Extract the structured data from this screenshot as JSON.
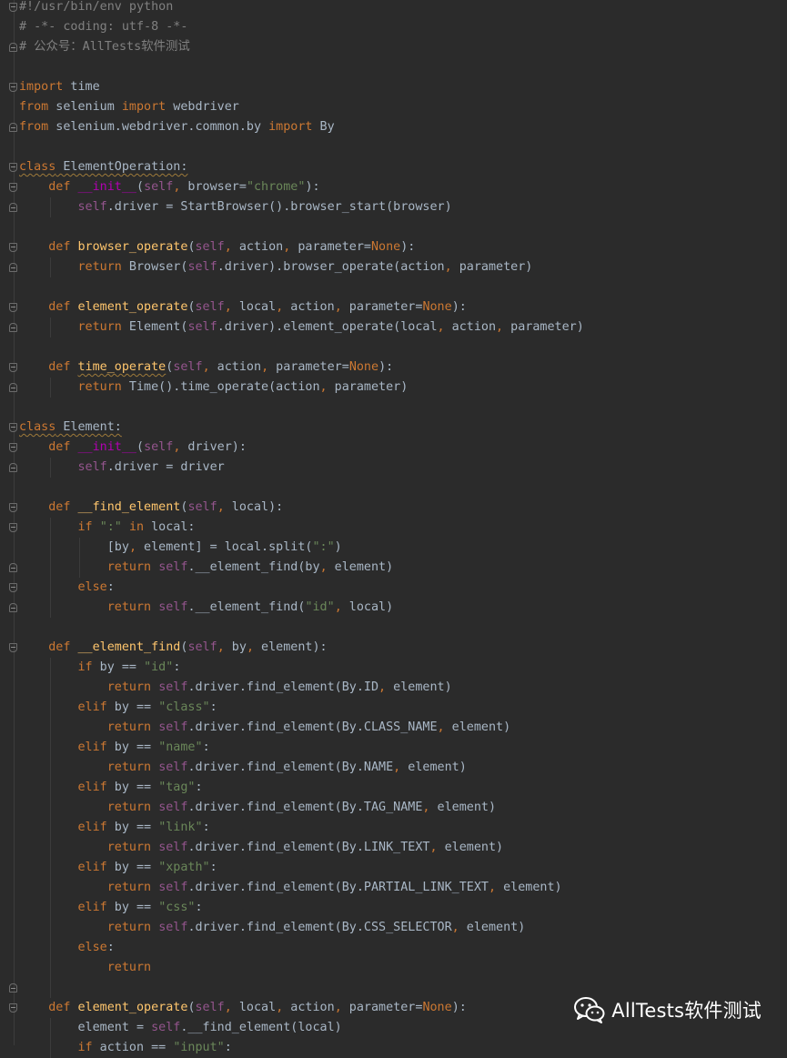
{
  "editor": {
    "language": "python",
    "colors": {
      "background": "#2b2b2b",
      "keyword": "#cc7832",
      "comment": "#808080",
      "string": "#6a8759",
      "self": "#94558d",
      "magic": "#b200b2",
      "function": "#ffc66d",
      "text": "#a9b7c6"
    },
    "lines": [
      [
        [
          "c",
          "#!/usr/bin/env python"
        ]
      ],
      [
        [
          "c",
          "# -*- coding: utf-8 -*-"
        ]
      ],
      [
        [
          "c",
          "# 公众号：AllTests软件测试"
        ]
      ],
      [],
      [
        [
          "k",
          "import"
        ],
        [
          "t",
          " time"
        ]
      ],
      [
        [
          "k",
          "from"
        ],
        [
          "t",
          " selenium "
        ],
        [
          "k",
          "import"
        ],
        [
          "t",
          " webdriver"
        ]
      ],
      [
        [
          "k",
          "from"
        ],
        [
          "t",
          " selenium.webdriver.common.by "
        ],
        [
          "k",
          "import"
        ],
        [
          "t",
          " By"
        ]
      ],
      [],
      [
        [
          "ku",
          "class"
        ],
        [
          "tu",
          " ElementOperation:"
        ]
      ],
      [
        [
          "t",
          "    "
        ],
        [
          "k",
          "def"
        ],
        [
          "t",
          " "
        ],
        [
          "m",
          "__init__"
        ],
        [
          "t",
          "("
        ],
        [
          "sf",
          "self"
        ],
        [
          "k",
          ","
        ],
        [
          "t",
          " browser="
        ],
        [
          "s",
          "\"chrome\""
        ],
        [
          "t",
          "):"
        ]
      ],
      [
        [
          "t",
          "        "
        ],
        [
          "sf",
          "self"
        ],
        [
          "t",
          ".driver = StartBrowser().browser_start(browser)"
        ]
      ],
      [],
      [
        [
          "t",
          "    "
        ],
        [
          "k",
          "def"
        ],
        [
          "t",
          " "
        ],
        [
          "f",
          "browser_operate"
        ],
        [
          "t",
          "("
        ],
        [
          "sf",
          "self"
        ],
        [
          "k",
          ","
        ],
        [
          "t",
          " action"
        ],
        [
          "k",
          ","
        ],
        [
          "t",
          " parameter="
        ],
        [
          "k",
          "None"
        ],
        [
          "t",
          "):"
        ]
      ],
      [
        [
          "t",
          "        "
        ],
        [
          "k",
          "return"
        ],
        [
          "t",
          " Browser("
        ],
        [
          "sf",
          "self"
        ],
        [
          "t",
          ".driver).browser_operate(action"
        ],
        [
          "k",
          ","
        ],
        [
          "t",
          " parameter)"
        ]
      ],
      [],
      [
        [
          "t",
          "    "
        ],
        [
          "k",
          "def"
        ],
        [
          "t",
          " "
        ],
        [
          "f",
          "element_operate"
        ],
        [
          "t",
          "("
        ],
        [
          "sf",
          "self"
        ],
        [
          "k",
          ","
        ],
        [
          "t",
          " local"
        ],
        [
          "k",
          ","
        ],
        [
          "t",
          " action"
        ],
        [
          "k",
          ","
        ],
        [
          "t",
          " parameter="
        ],
        [
          "k",
          "None"
        ],
        [
          "t",
          "):"
        ]
      ],
      [
        [
          "t",
          "        "
        ],
        [
          "k",
          "return"
        ],
        [
          "t",
          " Element("
        ],
        [
          "sf",
          "self"
        ],
        [
          "t",
          ".driver).element_operate(local"
        ],
        [
          "k",
          ","
        ],
        [
          "t",
          " action"
        ],
        [
          "k",
          ","
        ],
        [
          "t",
          " parameter)"
        ]
      ],
      [],
      [
        [
          "t",
          "    "
        ],
        [
          "k",
          "def"
        ],
        [
          "t",
          " "
        ],
        [
          "fu",
          "time_operate"
        ],
        [
          "t",
          "("
        ],
        [
          "sf",
          "self"
        ],
        [
          "k",
          ","
        ],
        [
          "t",
          " action"
        ],
        [
          "k",
          ","
        ],
        [
          "t",
          " parameter="
        ],
        [
          "k",
          "None"
        ],
        [
          "t",
          "):"
        ]
      ],
      [
        [
          "t",
          "        "
        ],
        [
          "k",
          "return"
        ],
        [
          "t",
          " Time().time_operate(action"
        ],
        [
          "k",
          ","
        ],
        [
          "t",
          " parameter)"
        ]
      ],
      [],
      [
        [
          "ku",
          "class"
        ],
        [
          "tu",
          " Element:"
        ]
      ],
      [
        [
          "t",
          "    "
        ],
        [
          "k",
          "def"
        ],
        [
          "t",
          " "
        ],
        [
          "m",
          "__init__"
        ],
        [
          "t",
          "("
        ],
        [
          "sf",
          "self"
        ],
        [
          "k",
          ","
        ],
        [
          "t",
          " driver):"
        ]
      ],
      [
        [
          "t",
          "        "
        ],
        [
          "sf",
          "self"
        ],
        [
          "t",
          ".driver = driver"
        ]
      ],
      [],
      [
        [
          "t",
          "    "
        ],
        [
          "k",
          "def"
        ],
        [
          "t",
          " "
        ],
        [
          "f",
          "__find_element"
        ],
        [
          "t",
          "("
        ],
        [
          "sf",
          "self"
        ],
        [
          "k",
          ","
        ],
        [
          "t",
          " local):"
        ]
      ],
      [
        [
          "t",
          "        "
        ],
        [
          "k",
          "if"
        ],
        [
          "t",
          " "
        ],
        [
          "s",
          "\":\""
        ],
        [
          "t",
          " "
        ],
        [
          "k",
          "in"
        ],
        [
          "t",
          " local:"
        ]
      ],
      [
        [
          "t",
          "            [by"
        ],
        [
          "k",
          ","
        ],
        [
          "t",
          " element] = local.split("
        ],
        [
          "s",
          "\":\""
        ],
        [
          "t",
          ")"
        ]
      ],
      [
        [
          "t",
          "            "
        ],
        [
          "k",
          "return"
        ],
        [
          "t",
          " "
        ],
        [
          "sf",
          "self"
        ],
        [
          "t",
          ".__element_find(by"
        ],
        [
          "k",
          ","
        ],
        [
          "t",
          " element)"
        ]
      ],
      [
        [
          "t",
          "        "
        ],
        [
          "k",
          "else"
        ],
        [
          "t",
          ":"
        ]
      ],
      [
        [
          "t",
          "            "
        ],
        [
          "k",
          "return"
        ],
        [
          "t",
          " "
        ],
        [
          "sf",
          "self"
        ],
        [
          "t",
          ".__element_find("
        ],
        [
          "s",
          "\"id\""
        ],
        [
          "k",
          ","
        ],
        [
          "t",
          " local)"
        ]
      ],
      [],
      [
        [
          "t",
          "    "
        ],
        [
          "k",
          "def"
        ],
        [
          "t",
          " "
        ],
        [
          "f",
          "__element_find"
        ],
        [
          "t",
          "("
        ],
        [
          "sf",
          "self"
        ],
        [
          "k",
          ","
        ],
        [
          "t",
          " by"
        ],
        [
          "k",
          ","
        ],
        [
          "t",
          " element):"
        ]
      ],
      [
        [
          "t",
          "        "
        ],
        [
          "k",
          "if"
        ],
        [
          "t",
          " by == "
        ],
        [
          "s",
          "\"id\""
        ],
        [
          "t",
          ":"
        ]
      ],
      [
        [
          "t",
          "            "
        ],
        [
          "k",
          "return"
        ],
        [
          "t",
          " "
        ],
        [
          "sf",
          "self"
        ],
        [
          "t",
          ".driver.find_element(By.ID"
        ],
        [
          "k",
          ","
        ],
        [
          "t",
          " element)"
        ]
      ],
      [
        [
          "t",
          "        "
        ],
        [
          "k",
          "elif"
        ],
        [
          "t",
          " by == "
        ],
        [
          "s",
          "\"class\""
        ],
        [
          "t",
          ":"
        ]
      ],
      [
        [
          "t",
          "            "
        ],
        [
          "k",
          "return"
        ],
        [
          "t",
          " "
        ],
        [
          "sf",
          "self"
        ],
        [
          "t",
          ".driver.find_element(By.CLASS_NAME"
        ],
        [
          "k",
          ","
        ],
        [
          "t",
          " element)"
        ]
      ],
      [
        [
          "t",
          "        "
        ],
        [
          "k",
          "elif"
        ],
        [
          "t",
          " by == "
        ],
        [
          "s",
          "\"name\""
        ],
        [
          "t",
          ":"
        ]
      ],
      [
        [
          "t",
          "            "
        ],
        [
          "k",
          "return"
        ],
        [
          "t",
          " "
        ],
        [
          "sf",
          "self"
        ],
        [
          "t",
          ".driver.find_element(By.NAME"
        ],
        [
          "k",
          ","
        ],
        [
          "t",
          " element)"
        ]
      ],
      [
        [
          "t",
          "        "
        ],
        [
          "k",
          "elif"
        ],
        [
          "t",
          " by == "
        ],
        [
          "s",
          "\"tag\""
        ],
        [
          "t",
          ":"
        ]
      ],
      [
        [
          "t",
          "            "
        ],
        [
          "k",
          "return"
        ],
        [
          "t",
          " "
        ],
        [
          "sf",
          "self"
        ],
        [
          "t",
          ".driver.find_element(By.TAG_NAME"
        ],
        [
          "k",
          ","
        ],
        [
          "t",
          " element)"
        ]
      ],
      [
        [
          "t",
          "        "
        ],
        [
          "k",
          "elif"
        ],
        [
          "t",
          " by == "
        ],
        [
          "s",
          "\"link\""
        ],
        [
          "t",
          ":"
        ]
      ],
      [
        [
          "t",
          "            "
        ],
        [
          "k",
          "return"
        ],
        [
          "t",
          " "
        ],
        [
          "sf",
          "self"
        ],
        [
          "t",
          ".driver.find_element(By.LINK_TEXT"
        ],
        [
          "k",
          ","
        ],
        [
          "t",
          " element)"
        ]
      ],
      [
        [
          "t",
          "        "
        ],
        [
          "k",
          "elif"
        ],
        [
          "t",
          " by == "
        ],
        [
          "s",
          "\"xpath\""
        ],
        [
          "t",
          ":"
        ]
      ],
      [
        [
          "t",
          "            "
        ],
        [
          "k",
          "return"
        ],
        [
          "t",
          " "
        ],
        [
          "sf",
          "self"
        ],
        [
          "t",
          ".driver.find_element(By.PARTIAL_LINK_TEXT"
        ],
        [
          "k",
          ","
        ],
        [
          "t",
          " element)"
        ]
      ],
      [
        [
          "t",
          "        "
        ],
        [
          "k",
          "elif"
        ],
        [
          "t",
          " by == "
        ],
        [
          "s",
          "\"css\""
        ],
        [
          "t",
          ":"
        ]
      ],
      [
        [
          "t",
          "            "
        ],
        [
          "k",
          "return"
        ],
        [
          "t",
          " "
        ],
        [
          "sf",
          "self"
        ],
        [
          "t",
          ".driver.find_element(By.CSS_SELECTOR"
        ],
        [
          "k",
          ","
        ],
        [
          "t",
          " element)"
        ]
      ],
      [
        [
          "t",
          "        "
        ],
        [
          "k",
          "else"
        ],
        [
          "t",
          ":"
        ]
      ],
      [
        [
          "t",
          "            "
        ],
        [
          "k",
          "return"
        ]
      ],
      [],
      [
        [
          "t",
          "    "
        ],
        [
          "k",
          "def"
        ],
        [
          "t",
          " "
        ],
        [
          "f",
          "element_operate"
        ],
        [
          "t",
          "("
        ],
        [
          "sf",
          "self"
        ],
        [
          "k",
          ","
        ],
        [
          "t",
          " local"
        ],
        [
          "k",
          ","
        ],
        [
          "t",
          " action"
        ],
        [
          "k",
          ","
        ],
        [
          "t",
          " parameter="
        ],
        [
          "k",
          "None"
        ],
        [
          "t",
          "):"
        ]
      ],
      [
        [
          "t",
          "        element = "
        ],
        [
          "sf",
          "self"
        ],
        [
          "t",
          ".__find_element(local)"
        ]
      ],
      [
        [
          "t",
          "        "
        ],
        [
          "k",
          "if"
        ],
        [
          "t",
          " action == "
        ],
        [
          "s",
          "\"input\""
        ],
        [
          "t",
          ":"
        ]
      ]
    ]
  },
  "watermark": {
    "icon": "wechat-icon",
    "text": "AllTests软件测试"
  }
}
